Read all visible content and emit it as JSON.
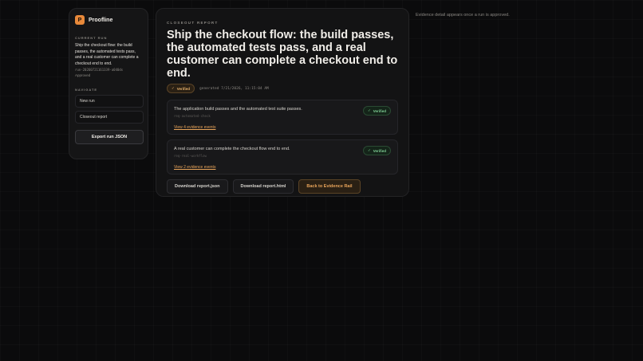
{
  "brand": {
    "name": "Proofline",
    "logo_glyph": "P",
    "accent": "#e8893a"
  },
  "sidebar": {
    "current_run_label": "CURRENT RUN",
    "run_title": "Ship the checkout flow: the build passes, the automated tests pass, and a real customer can complete a checkout end to end.",
    "run_id": "run-20260721161339-a040ds",
    "run_status": "Approved",
    "navigate_label": "NAVIGATE",
    "nav_items": [
      {
        "label": "New run"
      },
      {
        "label": "Closeout report"
      }
    ],
    "export_label": "Export run JSON"
  },
  "report": {
    "eyebrow": "CLOSEOUT REPORT",
    "title": "Ship the checkout flow: the build passes, the automated tests pass, and a real customer can complete a checkout end to end.",
    "status_label": "Verified",
    "generated": "generated 7/21/2026, 11:15:04 AM",
    "claims": [
      {
        "text": "The application build passes and the automated test suite passes.",
        "ref": "req-automated-check",
        "link": "View 4 evidence events",
        "badge": "Verified"
      },
      {
        "text": "A real customer can complete the checkout flow end to end.",
        "ref": "req-real-workflow",
        "link": "View 2 evidence events",
        "badge": "Verified"
      }
    ],
    "actions": {
      "download_json": "Download report.json",
      "download_html": "Download report.html",
      "back": "Back to Evidence Rail"
    }
  },
  "aside_note": "Evidence detail appears once a run is approved."
}
